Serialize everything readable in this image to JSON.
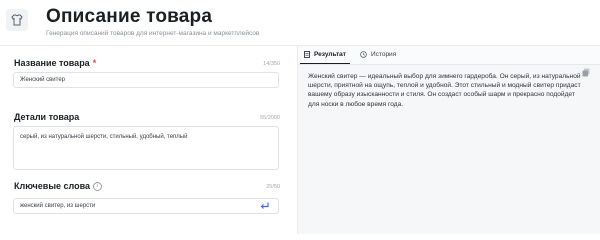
{
  "header": {
    "title": "Описание товара",
    "subtitle": "Генерация описаний товаров для интернет-магазина и маркетплейсов",
    "logo_icon": "shirt-icon"
  },
  "form": {
    "name": {
      "label": "Название товара",
      "required_mark": "*",
      "counter": "14/350",
      "value": "Женский свитер"
    },
    "details": {
      "label": "Детали товара",
      "counter": "55/2000",
      "value": "серый, из натуральной шерсти, стильный, удобный, теплый"
    },
    "keywords": {
      "label": "Ключевые слова",
      "info_icon": "info-icon",
      "counter": "25/50",
      "value": "женский свитер, из шерсти",
      "submit_icon": "enter-icon"
    }
  },
  "output": {
    "tabs": [
      {
        "label": "Результат",
        "icon": "document-icon",
        "active": true
      },
      {
        "label": "История",
        "icon": "clock-icon",
        "active": false
      }
    ],
    "copy_icon": "copy-icon",
    "text": "Женский свитер — идеальный выбор для зимнего гардероба. Он серый, из натуральной шерсти, приятной на ощупь, теплой и удобной. Этот стильный и модный свитер придаст вашему образу изысканности и стиля. Он создаст особый шарм и прекрасно подойдет для носки в любое время года."
  },
  "colors": {
    "accent": "#1b1f24",
    "required": "#e5484d",
    "submit": "#4a6cf7"
  }
}
